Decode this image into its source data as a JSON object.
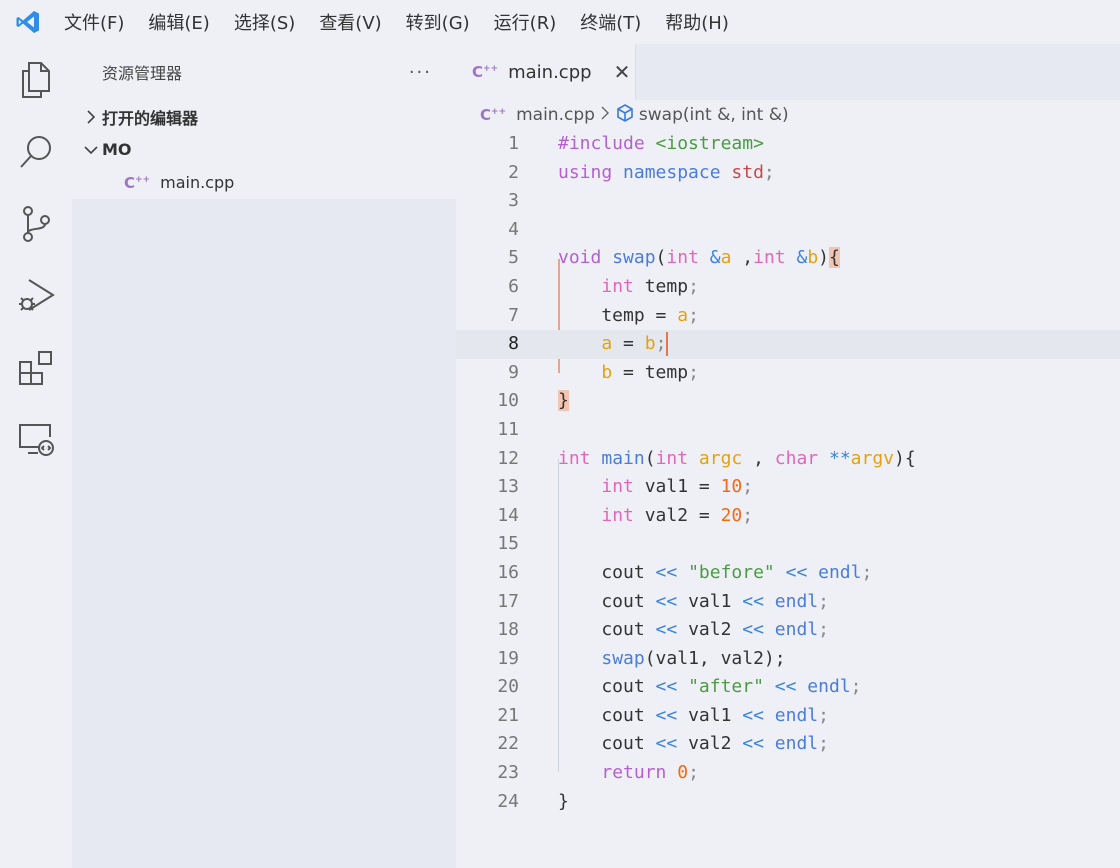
{
  "menu": {
    "items": [
      "文件(F)",
      "编辑(E)",
      "选择(S)",
      "查看(V)",
      "转到(G)",
      "运行(R)",
      "终端(T)",
      "帮助(H)"
    ]
  },
  "activity_bar": {
    "icons": [
      "explorer-icon",
      "search-icon",
      "source-control-icon",
      "run-debug-icon",
      "extensions-icon",
      "remote-explorer-icon"
    ]
  },
  "sidebar": {
    "title": "资源管理器",
    "more": "···",
    "open_editors": "打开的编辑器",
    "folder": "MO",
    "file": "main.cpp"
  },
  "editor": {
    "tab_label": "main.cpp",
    "breadcrumb_file": "main.cpp",
    "breadcrumb_symbol": "swap(int &, int &)",
    "current_line": 8,
    "lines": [
      [
        [
          "t-kw",
          "#include "
        ],
        [
          "t-str",
          "<iostream>"
        ]
      ],
      [
        [
          "t-kw",
          "using "
        ],
        [
          "t-fn",
          "namespace "
        ],
        [
          "t-ns",
          "std"
        ],
        [
          "t-punct",
          ";"
        ]
      ],
      [],
      [],
      [
        [
          "t-kw",
          "void "
        ],
        [
          "t-fn",
          "swap"
        ],
        [
          "t-pl",
          "("
        ],
        [
          "t-type",
          "int "
        ],
        [
          "t-op",
          "&"
        ],
        [
          "t-var",
          "a"
        ],
        [
          "t-pl",
          " ,"
        ],
        [
          "t-type",
          "int "
        ],
        [
          "t-op",
          "&"
        ],
        [
          "t-var",
          "b"
        ],
        [
          "t-pl",
          ")"
        ],
        [
          "bracket",
          "{"
        ]
      ],
      [
        [
          "t-pl",
          "    "
        ],
        [
          "t-type",
          "int "
        ],
        [
          "t-pl",
          "temp"
        ],
        [
          "t-punct",
          ";"
        ]
      ],
      [
        [
          "t-pl",
          "    temp = "
        ],
        [
          "t-var",
          "a"
        ],
        [
          "t-punct",
          ";"
        ]
      ],
      [
        [
          "t-pl",
          "    "
        ],
        [
          "t-var",
          "a"
        ],
        [
          "t-pl",
          " = "
        ],
        [
          "t-var",
          "b"
        ],
        [
          "t-punct",
          ";"
        ],
        [
          "cursor",
          ""
        ]
      ],
      [
        [
          "t-pl",
          "    "
        ],
        [
          "t-var",
          "b"
        ],
        [
          "t-pl",
          " = temp"
        ],
        [
          "t-punct",
          ";"
        ]
      ],
      [
        [
          "bracket",
          "}"
        ]
      ],
      [],
      [
        [
          "t-type",
          "int "
        ],
        [
          "t-fn",
          "main"
        ],
        [
          "t-pl",
          "("
        ],
        [
          "t-type",
          "int "
        ],
        [
          "t-var",
          "argc "
        ],
        [
          "t-pl",
          ", "
        ],
        [
          "t-type",
          "char "
        ],
        [
          "t-op",
          "**"
        ],
        [
          "t-var",
          "argv"
        ],
        [
          "t-pl",
          "){"
        ]
      ],
      [
        [
          "t-pl",
          "    "
        ],
        [
          "t-type",
          "int "
        ],
        [
          "t-pl",
          "val1 = "
        ],
        [
          "t-num",
          "10"
        ],
        [
          "t-punct",
          ";"
        ]
      ],
      [
        [
          "t-pl",
          "    "
        ],
        [
          "t-type",
          "int "
        ],
        [
          "t-pl",
          "val2 = "
        ],
        [
          "t-num",
          "20"
        ],
        [
          "t-punct",
          ";"
        ]
      ],
      [],
      [
        [
          "t-pl",
          "    cout "
        ],
        [
          "t-op",
          "<< "
        ],
        [
          "t-str",
          "\"before\" "
        ],
        [
          "t-op",
          "<< "
        ],
        [
          "t-fn",
          "endl"
        ],
        [
          "t-punct",
          ";"
        ]
      ],
      [
        [
          "t-pl",
          "    cout "
        ],
        [
          "t-op",
          "<< "
        ],
        [
          "t-pl",
          "val1 "
        ],
        [
          "t-op",
          "<< "
        ],
        [
          "t-fn",
          "endl"
        ],
        [
          "t-punct",
          ";"
        ]
      ],
      [
        [
          "t-pl",
          "    cout "
        ],
        [
          "t-op",
          "<< "
        ],
        [
          "t-pl",
          "val2 "
        ],
        [
          "t-op",
          "<< "
        ],
        [
          "t-fn",
          "endl"
        ],
        [
          "t-punct",
          ";"
        ]
      ],
      [
        [
          "t-pl",
          "    "
        ],
        [
          "t-fn",
          "swap"
        ],
        [
          "t-pl",
          "(val1, val2);"
        ]
      ],
      [
        [
          "t-pl",
          "    cout "
        ],
        [
          "t-op",
          "<< "
        ],
        [
          "t-str",
          "\"after\" "
        ],
        [
          "t-op",
          "<< "
        ],
        [
          "t-fn",
          "endl"
        ],
        [
          "t-punct",
          ";"
        ]
      ],
      [
        [
          "t-pl",
          "    cout "
        ],
        [
          "t-op",
          "<< "
        ],
        [
          "t-pl",
          "val1 "
        ],
        [
          "t-op",
          "<< "
        ],
        [
          "t-fn",
          "endl"
        ],
        [
          "t-punct",
          ";"
        ]
      ],
      [
        [
          "t-pl",
          "    cout "
        ],
        [
          "t-op",
          "<< "
        ],
        [
          "t-pl",
          "val2 "
        ],
        [
          "t-op",
          "<< "
        ],
        [
          "t-fn",
          "endl"
        ],
        [
          "t-punct",
          ";"
        ]
      ],
      [
        [
          "t-pl",
          "    "
        ],
        [
          "t-kw",
          "return "
        ],
        [
          "t-num",
          "0"
        ],
        [
          "t-punct",
          ";"
        ]
      ],
      [
        [
          "t-pl",
          "}"
        ]
      ]
    ]
  }
}
